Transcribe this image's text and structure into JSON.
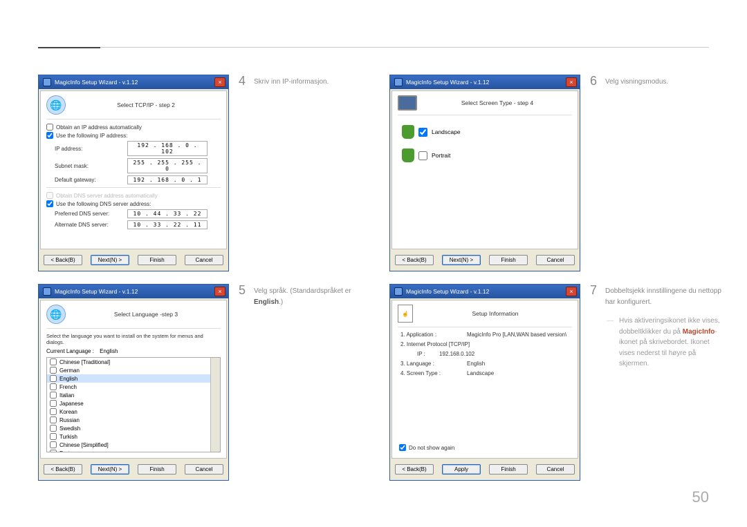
{
  "page_number": "50",
  "window_title": "MagicInfo Setup Wizard - v.1.12",
  "buttons": {
    "back": "< Back(B)",
    "next": "Next(N) >",
    "finish": "Finish",
    "cancel": "Cancel",
    "apply": "Apply"
  },
  "steps": {
    "4": {
      "num": "4",
      "text": "Skriv inn IP-informasjon."
    },
    "5": {
      "num": "5",
      "text_a": "Velg språk. (Standardspråket er ",
      "text_bold": "English",
      "text_b": ".)"
    },
    "6": {
      "num": "6",
      "text": "Velg visningsmodus."
    },
    "7": {
      "num": "7",
      "text": "Dobbeltsjekk innstillingene du nettopp har konfigurert."
    }
  },
  "tip": {
    "pre": "Hvis aktiveringsikonet ikke vises, dobbeltklikker du på ",
    "highlight": "MagicInfo",
    "post": "-ikonet på skrivebordet. Ikonet vises nederst til høyre på skjermen."
  },
  "shot4": {
    "header": "Select TCP/IP - step 2",
    "obtain_auto": "Obtain an IP address automatically",
    "use_following": "Use the following IP address:",
    "ip_label": "IP address:",
    "ip_val": "192 . 168 . 0 . 102",
    "subnet_label": "Subnet mask:",
    "subnet_val": "255 . 255 . 255 . 0",
    "gateway_label": "Default gateway:",
    "gateway_val": "192 . 168 . 0 . 1",
    "obtain_dns_auto": "Obtain DNS server address automatically",
    "use_following_dns": "Use the following DNS server address:",
    "pref_dns_label": "Preferred DNS server:",
    "pref_dns_val": "10 . 44 . 33 . 22",
    "alt_dns_label": "Alternate DNS server:",
    "alt_dns_val": "10 . 33 . 22 . 11"
  },
  "shot5": {
    "header": "Select Language -step 3",
    "desc": "Select the language you want to install on the system for menus and dialogs.",
    "current_label": "Current Language  :",
    "current_value": "English",
    "languages": [
      "Chinese [Traditional]",
      "German",
      "English",
      "French",
      "Italian",
      "Japanese",
      "Korean",
      "Russian",
      "Swedish",
      "Turkish",
      "Chinese [Simplified]",
      "Portuguese"
    ]
  },
  "shot6": {
    "header": "Select Screen Type - step 4",
    "landscape": "Landscape",
    "portrait": "Portrait"
  },
  "shot7": {
    "header": "Setup Information",
    "l1k": "1. Application :",
    "l1v": "MagicInfo Pro [LAN,WAN based version\\",
    "l2k": "2. Internet Protocol [TCP/IP]",
    "ipk": "IP :",
    "ipv": "192.168.0.102",
    "l3k": "3. Language :",
    "l3v": "English",
    "l4k": "4. Screen Type :",
    "l4v": "Landscape",
    "do_not_show": "Do not show again"
  }
}
